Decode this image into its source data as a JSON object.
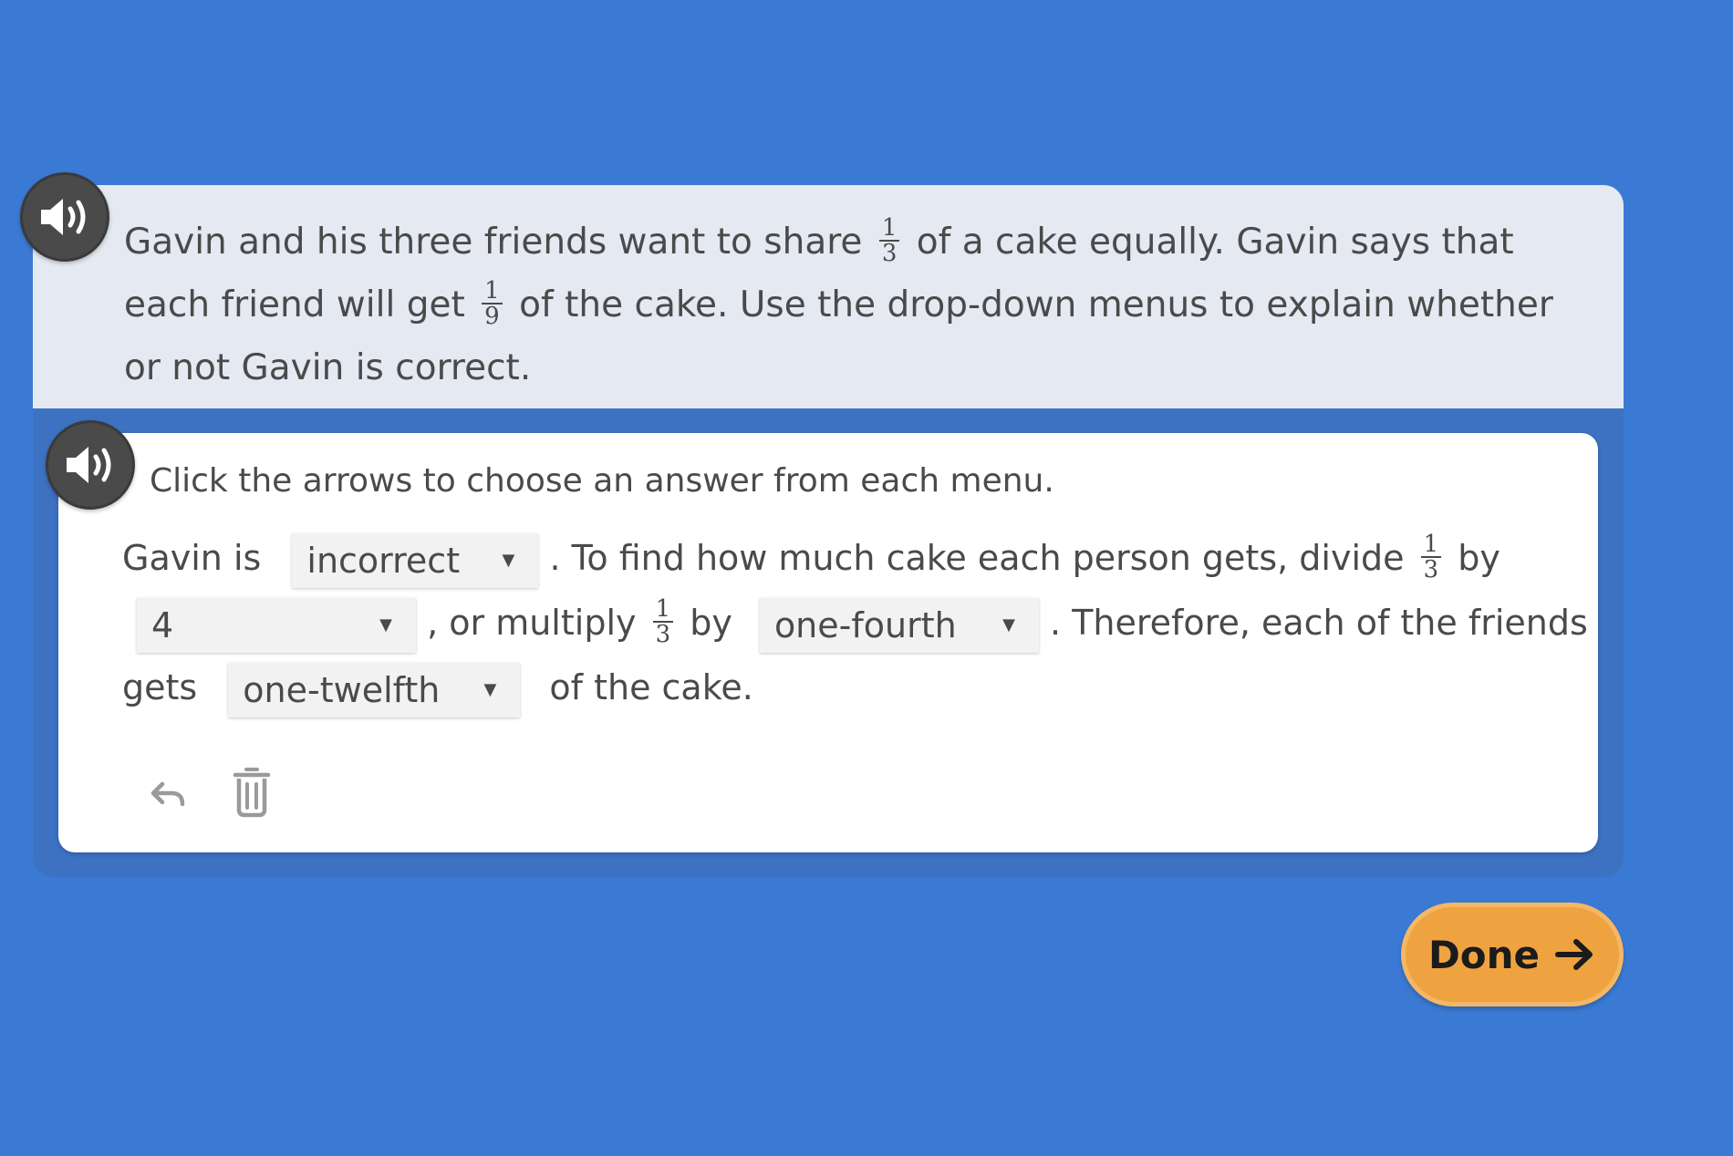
{
  "prompt": {
    "seg1": "Gavin and his three friends want to share",
    "frac1": {
      "num": "1",
      "den": "3"
    },
    "seg2": "of a cake equally. Gavin says that",
    "seg3": "each friend will get",
    "frac2": {
      "num": "1",
      "den": "9"
    },
    "seg4": "of the cake. Use the drop-down menus to explain whether",
    "seg5": "or not Gavin is correct."
  },
  "card": {
    "instruction": "Click the arrows to choose an answer from each menu.",
    "line1": {
      "prefix": "Gavin is",
      "mid": ". To find how much cake each person gets, divide",
      "frac": {
        "num": "1",
        "den": "3"
      },
      "suffix": "by"
    },
    "line2": {
      "mid": ", or multiply",
      "frac": {
        "num": "1",
        "den": "3"
      },
      "by": "by",
      "suffix": ". Therefore, each of the friends"
    },
    "line3": {
      "prefix": "gets",
      "suffix": "of the cake."
    },
    "dropdowns": {
      "correctness": "incorrect",
      "divisor": "4",
      "multiplier": "one-fourth",
      "result": "one-twelfth"
    }
  },
  "icons": {
    "audio": "speaker-icon",
    "undo": "undo-icon",
    "delete": "trash-icon",
    "done_arrow": "arrow-right-icon"
  },
  "done_button": {
    "label": "Done"
  },
  "colors": {
    "background": "#3b7ad4",
    "prompt_bg": "#e4e9f2",
    "done_bg": "#efa340",
    "audio_bg": "#4a4a4a"
  }
}
